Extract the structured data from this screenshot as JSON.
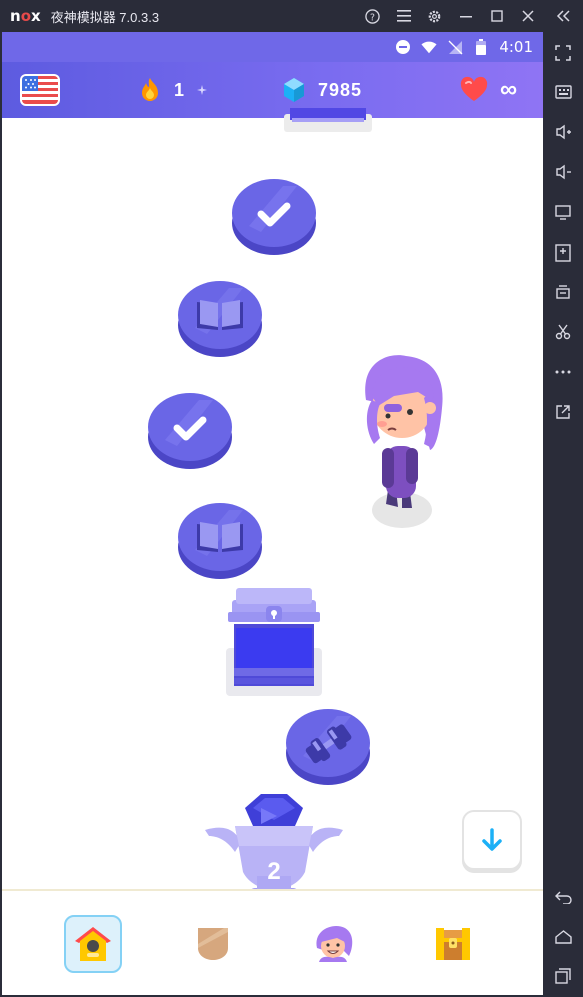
{
  "window": {
    "logo": "nox",
    "title": "夜神模拟器 7.0.3.3",
    "controls": [
      "help-icon",
      "menu-icon",
      "settings-icon",
      "minimize-icon",
      "maximize-icon",
      "close-icon",
      "collapse-icon"
    ]
  },
  "sidebar": {
    "tools": [
      "fullscreen-icon",
      "keyboard-icon",
      "volume-up-icon",
      "volume-down-icon",
      "screen-icon",
      "apk-install-icon",
      "multi-instance-icon",
      "scissors-icon",
      "more-icon",
      "open-external-icon",
      "back-icon",
      "home-icon",
      "recents-icon"
    ]
  },
  "status_bar": {
    "time": "4:01"
  },
  "top_bar": {
    "streak": "1",
    "gems": "7985",
    "hearts": "∞",
    "colors": {
      "bar": "#6f68e8",
      "streak": "#ff9600",
      "gems": "#1cb0f6",
      "hearts": "#ff4b4b"
    }
  },
  "path": {
    "nodes": [
      {
        "kind": "check",
        "state": "completed"
      },
      {
        "kind": "book",
        "state": "completed"
      },
      {
        "kind": "check",
        "state": "completed"
      },
      {
        "kind": "book",
        "state": "completed"
      },
      {
        "kind": "chest",
        "state": "opened"
      },
      {
        "kind": "dumbbell",
        "state": "completed"
      },
      {
        "kind": "trophy",
        "label": "2"
      }
    ],
    "node_color": "#6a66e6"
  },
  "scroll_button": {
    "icon": "arrow-down-icon"
  },
  "bottom_nav": {
    "tabs": [
      {
        "name": "home-tab",
        "icon": "home-icon",
        "active": true
      },
      {
        "name": "leagues-tab",
        "icon": "shield-icon",
        "active": false
      },
      {
        "name": "profile-tab",
        "icon": "avatar-icon",
        "active": false
      },
      {
        "name": "shop-tab",
        "icon": "chest-icon",
        "active": false
      }
    ]
  }
}
